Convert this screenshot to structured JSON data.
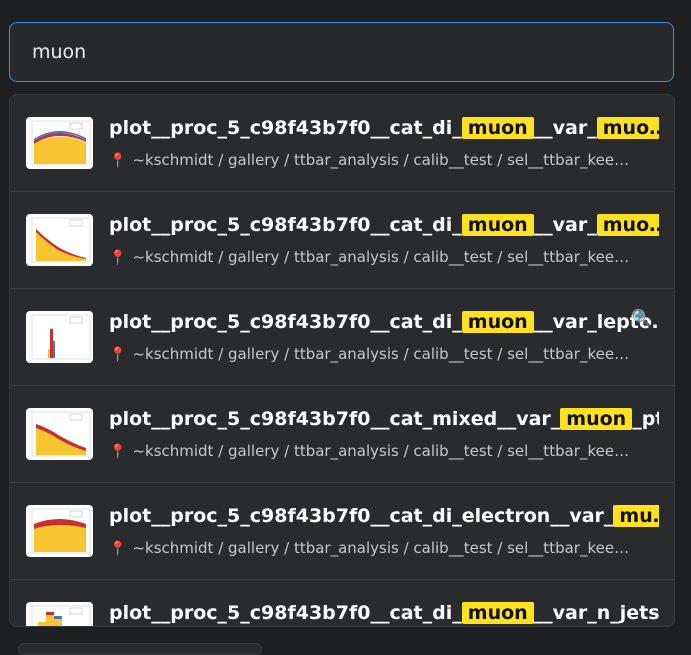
{
  "search": {
    "value": "muon"
  },
  "results": [
    {
      "title_pre": "plot__proc_5_c98f43b7f0__cat_di_",
      "hl1": "muon",
      "title_mid": "__var_",
      "hl2": "muo",
      "title_post": "…",
      "path": "~kschmidt / gallery / ttbar_analysis / calib__test / sel__ttbar_kee…"
    },
    {
      "title_pre": "plot__proc_5_c98f43b7f0__cat_di_",
      "hl1": "muon",
      "title_mid": "__var_",
      "hl2": "muo",
      "title_post": "…",
      "path": "~kschmidt / gallery / ttbar_analysis / calib__test / sel__ttbar_kee…"
    },
    {
      "title_pre": "plot__proc_5_c98f43b7f0__cat_di_",
      "hl1": "muon",
      "title_mid": "__var_lepto…",
      "path": "~kschmidt / gallery / ttbar_analysis / calib__test / sel__ttbar_kee…"
    },
    {
      "title_pre": "plot__proc_5_c98f43b7f0__cat_mixed__var_",
      "hl1": "muon",
      "title_mid": "_pt",
      "path": "~kschmidt / gallery / ttbar_analysis / calib__test / sel__ttbar_kee…"
    },
    {
      "title_pre": "plot__proc_5_c98f43b7f0__cat_di_electron__var_",
      "hl1": "mu",
      "title_mid": "",
      "hl1_post": "…",
      "path": "~kschmidt / gallery / ttbar_analysis / calib__test / sel__ttbar_kee…"
    },
    {
      "title_pre": "plot__proc_5_c98f43b7f0__cat_di_",
      "hl1": "muon",
      "title_mid": "__var_n_jets"
    }
  ],
  "icons": {
    "location": "pin-icon",
    "zoom": "magnifier-icon"
  },
  "colors": {
    "highlight": "#ffe11f",
    "focus_border": "#3b8fd9",
    "pin": "#e0413a"
  }
}
